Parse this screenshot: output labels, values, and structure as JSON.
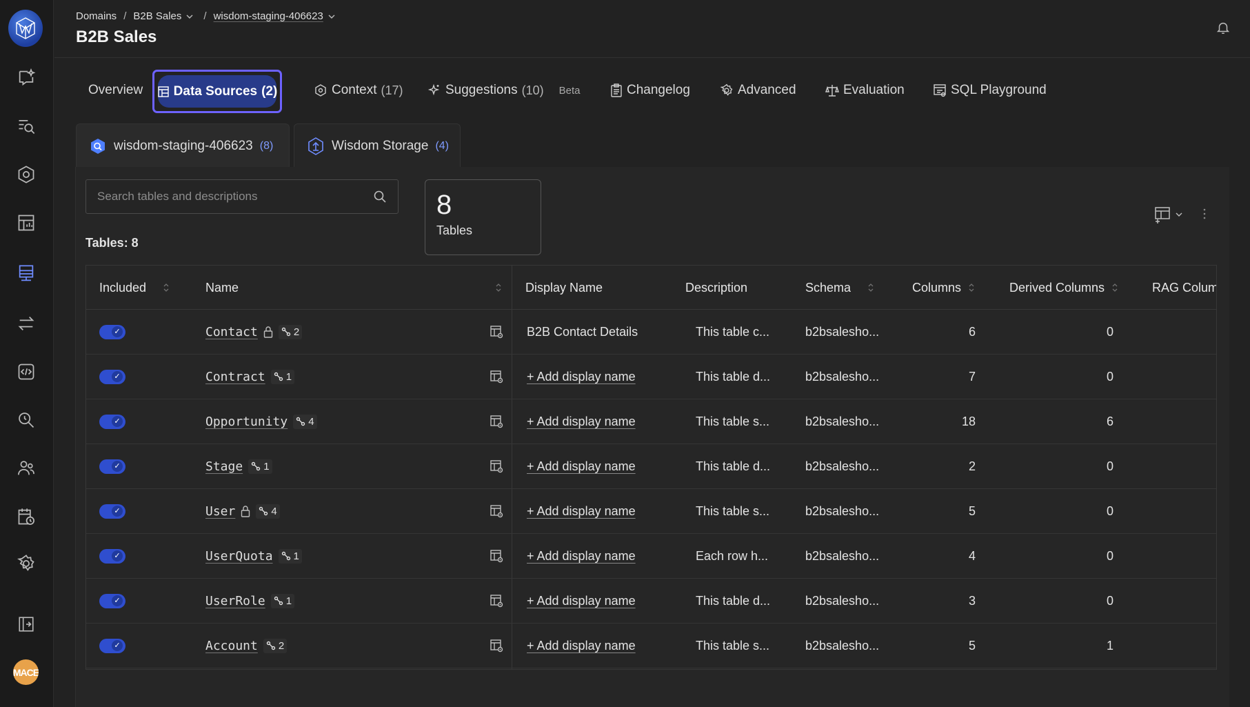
{
  "breadcrumb": {
    "items": [
      "Domains",
      "B2B Sales",
      "wisdom-staging-406623"
    ],
    "separator": "/"
  },
  "page_title": "B2B Sales",
  "tabs": [
    {
      "label": "Overview",
      "count": ""
    },
    {
      "label": "Data Sources",
      "count": "(2)"
    },
    {
      "label": "Context",
      "count": "(17)"
    },
    {
      "label": "Suggestions",
      "count": "(10)",
      "badge": "Beta"
    },
    {
      "label": "Changelog",
      "count": ""
    },
    {
      "label": "Advanced",
      "count": ""
    },
    {
      "label": "Evaluation",
      "count": ""
    },
    {
      "label": "SQL Playground",
      "count": ""
    }
  ],
  "subtabs": [
    {
      "label": "wisdom-staging-406623",
      "count": "(8)"
    },
    {
      "label": "Wisdom Storage",
      "count": "(4)"
    }
  ],
  "search": {
    "placeholder": "Search tables and descriptions"
  },
  "tables_count_label": "Tables: 8",
  "stat": {
    "value": "8",
    "label": "Tables"
  },
  "avatar_text": "MACE",
  "colors": {
    "accent": "#6d62ff",
    "active_tab_bg": "#283b8a",
    "toggle": "#2f4ecf"
  },
  "table": {
    "columns": [
      "Included",
      "Name",
      "Display Name",
      "Description",
      "Schema",
      "Columns",
      "Derived Columns",
      "RAG Colum"
    ],
    "rows": [
      {
        "name": "Contact",
        "locked": true,
        "relations": "2",
        "display_name": "B2B Contact Details",
        "description": "This table c...",
        "schema": "b2bsalesho...",
        "columns": "6",
        "derived": "0"
      },
      {
        "name": "Contract",
        "locked": false,
        "relations": "1",
        "display_name": "+ Add display name",
        "description": "This table d...",
        "schema": "b2bsalesho...",
        "columns": "7",
        "derived": "0"
      },
      {
        "name": "Opportunity",
        "locked": false,
        "relations": "4",
        "display_name": "+ Add display name",
        "description": "This table s...",
        "schema": "b2bsalesho...",
        "columns": "18",
        "derived": "6"
      },
      {
        "name": "Stage",
        "locked": false,
        "relations": "1",
        "display_name": "+ Add display name",
        "description": "This table d...",
        "schema": "b2bsalesho...",
        "columns": "2",
        "derived": "0"
      },
      {
        "name": "User",
        "locked": true,
        "relations": "4",
        "display_name": "+ Add display name",
        "description": "This table s...",
        "schema": "b2bsalesho...",
        "columns": "5",
        "derived": "0"
      },
      {
        "name": "UserQuota",
        "locked": false,
        "relations": "1",
        "display_name": "+ Add display name",
        "description": "Each row h...",
        "schema": "b2bsalesho...",
        "columns": "4",
        "derived": "0"
      },
      {
        "name": "UserRole",
        "locked": false,
        "relations": "1",
        "display_name": "+ Add display name",
        "description": "This table d...",
        "schema": "b2bsalesho...",
        "columns": "3",
        "derived": "0"
      },
      {
        "name": "Account",
        "locked": false,
        "relations": "2",
        "display_name": "+ Add display name",
        "description": "This table s...",
        "schema": "b2bsalesho...",
        "columns": "5",
        "derived": "1"
      }
    ]
  }
}
